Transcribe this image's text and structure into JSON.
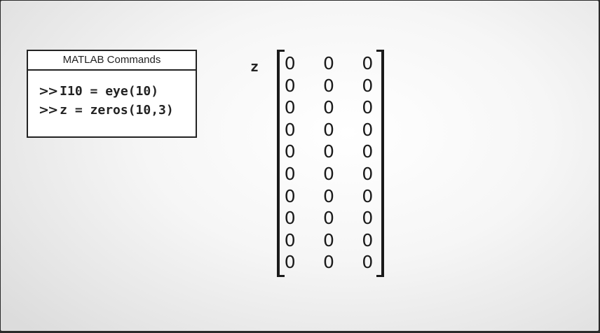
{
  "commands_panel": {
    "title": "MATLAB Commands",
    "prompt": ">>",
    "lines": [
      "I10 = eye(10)",
      "z = zeros(10,3)"
    ]
  },
  "result": {
    "variable": "z",
    "matrix": [
      [
        "0",
        "0",
        "0"
      ],
      [
        "0",
        "0",
        "0"
      ],
      [
        "0",
        "0",
        "0"
      ],
      [
        "0",
        "0",
        "0"
      ],
      [
        "0",
        "0",
        "0"
      ],
      [
        "0",
        "0",
        "0"
      ],
      [
        "0",
        "0",
        "0"
      ],
      [
        "0",
        "0",
        "0"
      ],
      [
        "0",
        "0",
        "0"
      ],
      [
        "0",
        "0",
        "0"
      ]
    ]
  }
}
